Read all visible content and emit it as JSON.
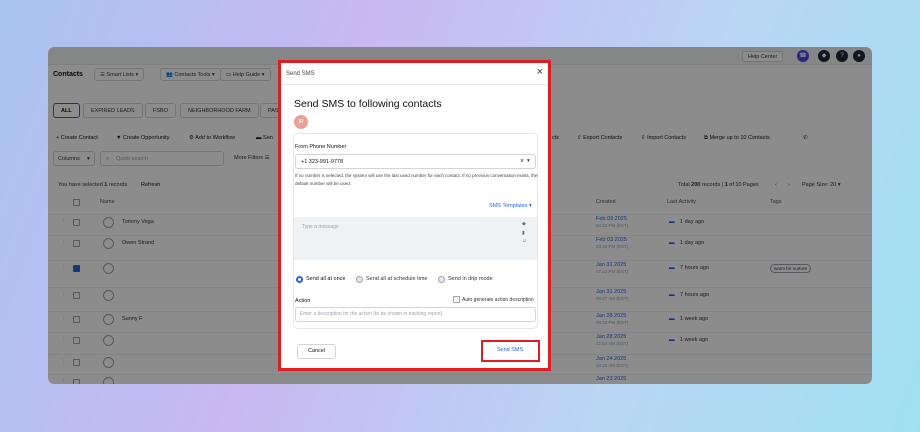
{
  "colors": {
    "accent": "#2563eb",
    "highlight": "#e11d24",
    "avatar_chip": "#e8a09a",
    "overlay": "rgba(0,0,0,0.45)"
  },
  "topbar": {
    "help_center": "Help Center"
  },
  "nav": {
    "title": "Contacts",
    "items": [
      {
        "label": "Smart Lists",
        "icon": "list-icon"
      },
      {
        "label": "Contacts Tools",
        "icon": "people-icon"
      },
      {
        "label": "Help Guide",
        "icon": "book-icon"
      }
    ]
  },
  "filters": {
    "tabs": [
      "ALL",
      "EXPIRED LEADS",
      "FSBO",
      "NEIGHBORHOOD FARM",
      "PAS"
    ]
  },
  "actions": {
    "create_contact": "+ Create Contact",
    "create_opportunity": "Create Opportunity",
    "add_to_workflow": "Add to Workflow",
    "send_partial": "Sen",
    "contacts_partial": "cts",
    "export": "Export Contacts",
    "import": "Import Contacts",
    "merge": "Merge up to 10 Contacts"
  },
  "toolbar": {
    "columns": "Columns",
    "search_placeholder": "Quick search",
    "more_filters": "More Filters"
  },
  "selection": {
    "text_prefix": "You have selected ",
    "count": "1",
    "text_suffix": " records",
    "refresh": "Refresh"
  },
  "pagination": {
    "total_prefix": "Total ",
    "total": "200",
    "total_middle": " records | ",
    "page": "1",
    "page_suffix": " of 10 Pages",
    "page_size": "Page Size: 20"
  },
  "table": {
    "headers": {
      "name": "Name",
      "created": "Created",
      "last_activity": "Last Activity",
      "tags": "Tags"
    },
    "rows": [
      {
        "name": "Tommy Vega",
        "created_date": "Feb 03 2025",
        "created_time": "04:33 PM (EST)",
        "activity": "1 day ago",
        "tag": "",
        "checked": false
      },
      {
        "name": "Owen Strand",
        "created_date": "Feb 03 2025",
        "created_time": "03:48 PM (EST)",
        "activity": "1 day ago",
        "tag": "",
        "checked": false
      },
      {
        "name": "",
        "created_date": "Jan 31 2025",
        "created_time": "07:22 PM (EST)",
        "activity": "7 hours ago",
        "tag": "warm for nurture",
        "checked": true
      },
      {
        "name": "",
        "created_date": "Jan 31 2025",
        "created_time": "06:47 AM (EST)",
        "activity": "7 hours ago",
        "tag": "",
        "checked": false
      },
      {
        "name": "Sunny F",
        "created_date": "Jan 28 2025",
        "created_time": "08:16 PM (EST)",
        "activity": "1 week ago",
        "tag": "",
        "checked": false
      },
      {
        "name": "",
        "created_date": "Jan 28 2025",
        "created_time": "12:54 AM (EST)",
        "activity": "1 week ago",
        "tag": "",
        "checked": false
      },
      {
        "name": "",
        "created_date": "Jan 24 2025",
        "created_time": "10:15 AM (EST)",
        "activity": "",
        "tag": "",
        "checked": false
      },
      {
        "name": "",
        "created_date": "Jan 23 2025",
        "created_time": "",
        "activity": "",
        "tag": "",
        "checked": false
      }
    ]
  },
  "modal": {
    "header": "Send SMS",
    "title": "Send SMS to following contacts",
    "contact_initials": "IR",
    "from_label": "From Phone Number",
    "from_value": "+1 323-991-9778",
    "note": "If no number is selected, the system will use the last used number for each contact. If no previous conversation exists, the default number will be used.",
    "templates": "SMS Templates",
    "message_placeholder": "Type a message",
    "send_modes": [
      {
        "label": "Send all at once",
        "selected": true
      },
      {
        "label": "Send all at schedule time",
        "selected": false
      },
      {
        "label": "Send in drip mode",
        "selected": false
      }
    ],
    "action_label": "Action",
    "auto_generate": "Auto generate action description",
    "description_placeholder": "Enter a description for the action (to be shown in tracking report)",
    "cancel": "Cancel",
    "send": "Send SMS"
  }
}
